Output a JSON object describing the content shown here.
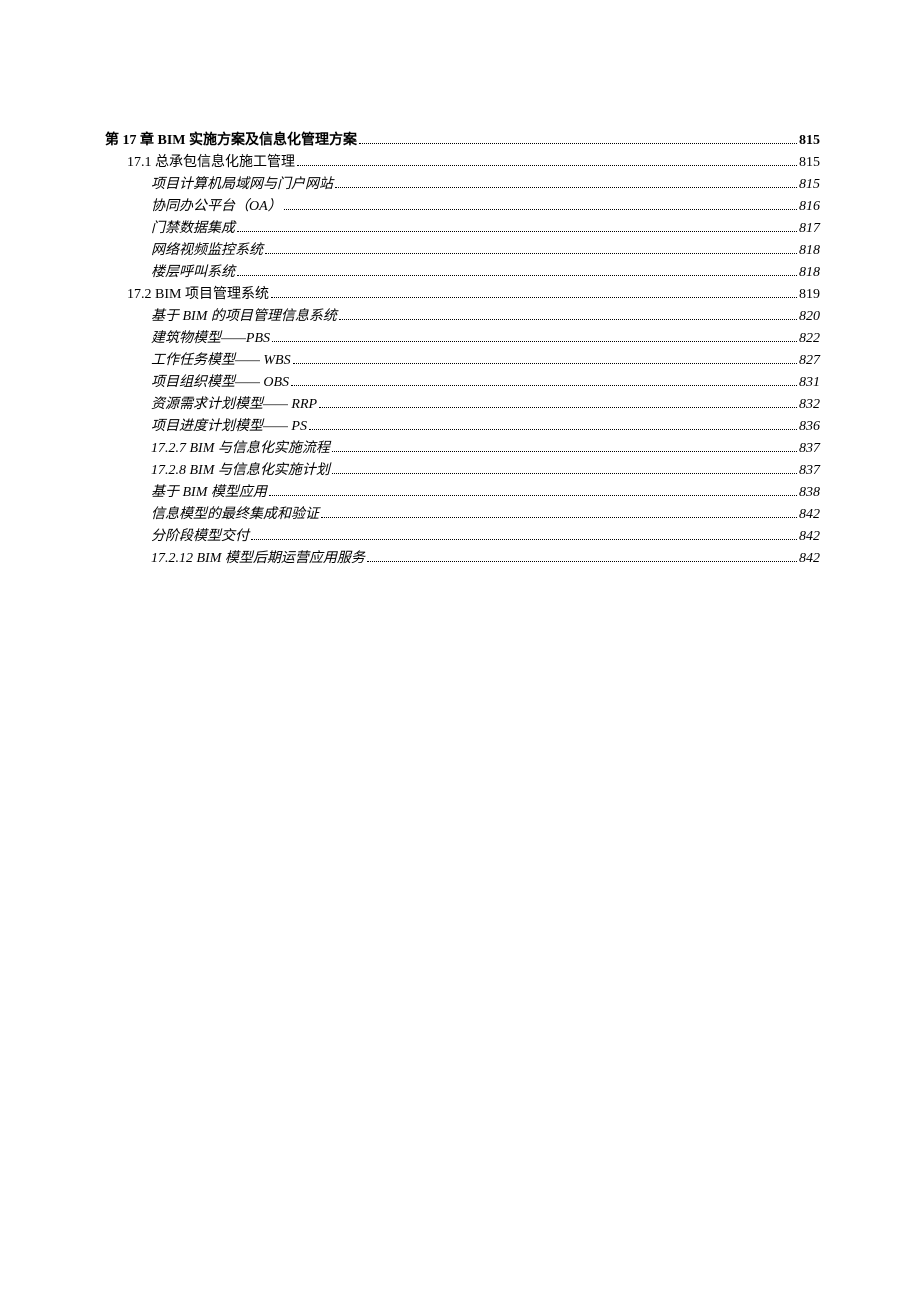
{
  "toc": [
    {
      "level": 0,
      "label": "第 17 章  BIM 实施方案及信息化管理方案 ",
      "page": "815"
    },
    {
      "level": 1,
      "label": "17.1 总承包信息化施工管理",
      "page": "815"
    },
    {
      "level": 2,
      "label": "项目计算机局域网与门户网站",
      "page": "815"
    },
    {
      "level": 2,
      "label": "协同办公平台（OA）",
      "page": "816"
    },
    {
      "level": 2,
      "label": "门禁数据集成",
      "page": "817"
    },
    {
      "level": 2,
      "label": "网络视频监控系统",
      "page": "818"
    },
    {
      "level": 2,
      "label": "楼层呼叫系统",
      "page": "818"
    },
    {
      "level": 1,
      "label": "17.2 BIM 项目管理系统 ",
      "page": "819"
    },
    {
      "level": 2,
      "label": "基于 BIM  的项目管理信息系统",
      "page": "820"
    },
    {
      "level": 2,
      "label": "建筑物模型——PBS ",
      "page": "822"
    },
    {
      "level": 2,
      "label": "工作任务模型—— WBS ",
      "page": "827"
    },
    {
      "level": 2,
      "label": "项目组织模型—— OBS",
      "page": "831"
    },
    {
      "level": 2,
      "label": "资源需求计划模型—— RRP",
      "page": "832"
    },
    {
      "level": 2,
      "label": "项目进度计划模型—— PS",
      "page": "836"
    },
    {
      "level": 2,
      "label": "17.2.7 BIM 与信息化实施流程",
      "page": "837"
    },
    {
      "level": 2,
      "label": "17.2.8 BIM 与信息化实施计划",
      "page": "837"
    },
    {
      "level": 2,
      "label": "基于 BIM 模型应用",
      "page": "838"
    },
    {
      "level": 2,
      "label": "信息模型的最终集成和验证",
      "page": "842"
    },
    {
      "level": 2,
      "label": "分阶段模型交付",
      "page": "842"
    },
    {
      "level": 2,
      "label": "17.2.12 BIM 模型后期运营应用服务 ",
      "page": "842"
    }
  ]
}
